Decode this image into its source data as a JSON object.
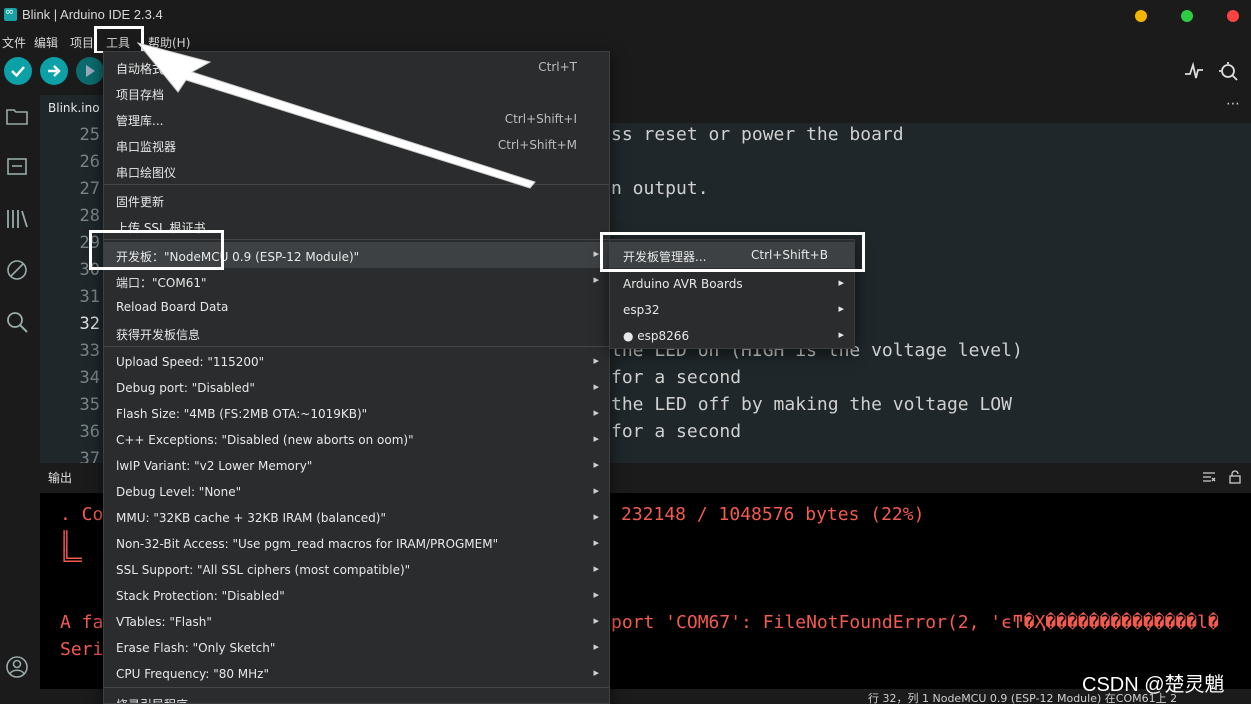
{
  "window": {
    "title": "Blink | Arduino IDE 2.3.4"
  },
  "menubar": {
    "items": [
      "文件",
      "编辑",
      "项目",
      "工具",
      "帮助(H)"
    ]
  },
  "editor": {
    "tab": "Blink.ino",
    "lines": [
      {
        "n": "25",
        "code": "ss reset or power the board"
      },
      {
        "n": "26",
        "code": ""
      },
      {
        "n": "27",
        "code": "n output."
      },
      {
        "n": "28",
        "code": ""
      },
      {
        "n": "29",
        "code": ""
      },
      {
        "n": "30",
        "code": ""
      },
      {
        "n": "31",
        "code": ""
      },
      {
        "n": "32",
        "code": ""
      },
      {
        "n": "33",
        "code": "the LED on (HIGH is the voltage level)"
      },
      {
        "n": "34",
        "code": "for a second"
      },
      {
        "n": "35",
        "code": "the LED off by making the voltage LOW"
      },
      {
        "n": "36",
        "code": "for a second"
      },
      {
        "n": "37",
        "code": ""
      }
    ]
  },
  "output": {
    "title": "输出",
    "lines": [
      ". Co",
      "║",
      "╚═",
      "",
      "A fa",
      "Seri"
    ],
    "right_lines": [
      {
        "text": "232148 / 1048576 bytes (22%)"
      },
      {
        "text": "port 'COM67': FileNotFoundError(2, 'ϵͳ�Ҳ���������ָ�����l�"
      }
    ]
  },
  "status": {
    "text": "行 32，列 1    NodeMCU 0.9 (ESP-12 Module) 在COM61上    2"
  },
  "watermark": "CSDN @楚灵魈",
  "tools_menu": {
    "items": [
      {
        "label": "自动格式化",
        "shortcut": "Ctrl+T"
      },
      {
        "label": "项目存档",
        "shortcut": ""
      },
      {
        "label": "管理库...",
        "shortcut": "Ctrl+Shift+I"
      },
      {
        "label": "串口监视器",
        "shortcut": "Ctrl+Shift+M"
      },
      {
        "label": "串口绘图仪",
        "shortcut": ""
      },
      {
        "label": "固件更新",
        "shortcut": ""
      },
      {
        "label": "上传 SSL 根证书",
        "shortcut": ""
      },
      {
        "label": "开发板：\"NodeMCU 0.9 (ESP-12 Module)\"",
        "shortcut": "",
        "submenu": true
      },
      {
        "label": "端口：\"COM61\"",
        "shortcut": "",
        "submenu": true
      },
      {
        "label": "Reload Board Data",
        "shortcut": ""
      },
      {
        "label": "获得开发板信息",
        "shortcut": ""
      },
      {
        "label": "Upload Speed: \"115200\"",
        "submenu": true
      },
      {
        "label": "Debug port: \"Disabled\"",
        "submenu": true
      },
      {
        "label": "Flash Size: \"4MB (FS:2MB OTA:~1019KB)\"",
        "submenu": true
      },
      {
        "label": "C++ Exceptions: \"Disabled (new aborts on oom)\"",
        "submenu": true
      },
      {
        "label": "lwIP Variant: \"v2 Lower Memory\"",
        "submenu": true
      },
      {
        "label": "Debug Level: \"None\"",
        "submenu": true
      },
      {
        "label": "MMU: \"32KB cache + 32KB IRAM (balanced)\"",
        "submenu": true
      },
      {
        "label": "Non-32-Bit Access: \"Use pgm_read macros for IRAM/PROGMEM\"",
        "submenu": true
      },
      {
        "label": "SSL Support: \"All SSL ciphers (most compatible)\"",
        "submenu": true
      },
      {
        "label": "Stack Protection: \"Disabled\"",
        "submenu": true
      },
      {
        "label": "VTables: \"Flash\"",
        "submenu": true
      },
      {
        "label": "Erase Flash: \"Only Sketch\"",
        "submenu": true
      },
      {
        "label": "CPU Frequency: \"80 MHz\"",
        "submenu": true
      },
      {
        "label": "烧录引导程序",
        "submenu": false
      }
    ]
  },
  "board_submenu": {
    "items": [
      {
        "label": "开发板管理器...",
        "shortcut": "Ctrl+Shift+B"
      },
      {
        "label": "Arduino AVR Boards",
        "submenu": true
      },
      {
        "label": "esp32",
        "submenu": true
      },
      {
        "label": "● esp8266",
        "submenu": true
      }
    ]
  },
  "colors": {
    "accent": "#0ca1a6",
    "error_text": "#f35b4f",
    "menu_bg": "#2a2c2d"
  }
}
